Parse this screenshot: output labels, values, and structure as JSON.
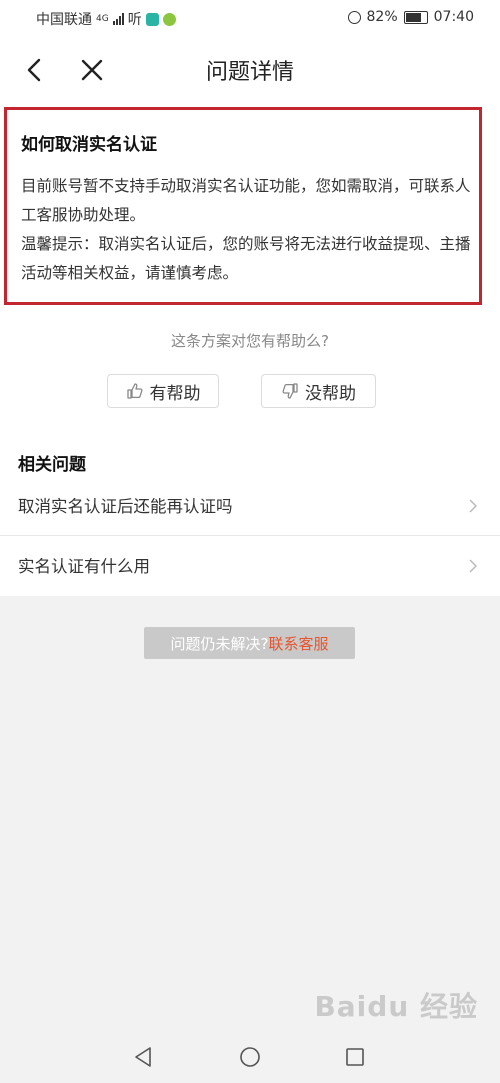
{
  "status_bar": {
    "carrier": "中国联通",
    "network": "4G",
    "app_badge": "听",
    "battery": "82%",
    "time": "07:40"
  },
  "header": {
    "title": "问题详情"
  },
  "answer": {
    "title": "如何取消实名认证",
    "body_line1": "目前账号暂不支持手动取消实名认证功能，您如需取消，可联系人工客服协助处理。",
    "body_line2": "温馨提示：取消实名认证后，您的账号将无法进行收益提现、主播活动等相关权益，请谨慎考虑。"
  },
  "feedback": {
    "prompt": "这条方案对您有帮助么?",
    "helpful_label": "有帮助",
    "unhelpful_label": "没帮助"
  },
  "related": {
    "heading": "相关问题",
    "items": [
      {
        "label": "取消实名认证后还能再认证吗"
      },
      {
        "label": "实名认证有什么用"
      }
    ]
  },
  "unresolved": {
    "text": "问题仍未解决?",
    "link": "联系客服"
  },
  "watermark": "Baidu 经验",
  "colors": {
    "highlight_border": "#c4262f",
    "link": "#e8542e"
  }
}
